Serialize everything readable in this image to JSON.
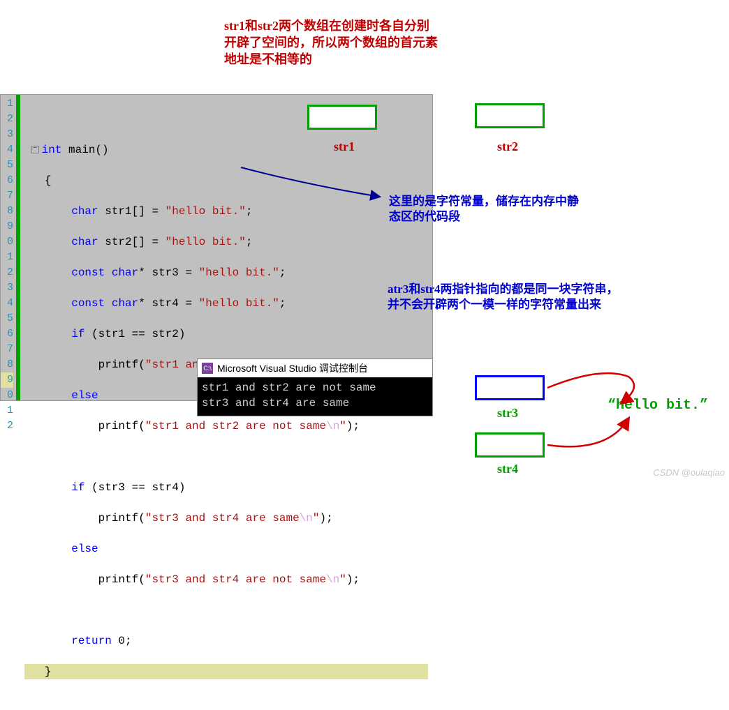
{
  "topNote": {
    "l1": "str1和str2两个数组在创建时各自分别",
    "l2": "开辟了空间的，所以两个数组的首元素",
    "l3": "地址是不相等的"
  },
  "gutterLines": [
    "1",
    "2",
    "3",
    "4",
    "5",
    "6",
    "7",
    "8",
    "9",
    "0",
    "1",
    "2",
    "3",
    "4",
    "5",
    "6",
    "7",
    "8",
    "9",
    "0",
    "1",
    "2"
  ],
  "code": {
    "kw_int": "int",
    "main": " main()",
    "brace_open": "{",
    "brace_close": "}",
    "kw_char": "char",
    "kw_const": "const",
    "kw_if": "if",
    "kw_else": "else",
    "kw_return": "return",
    "str1_decl": " str1[] = ",
    "str2_decl": " str2[] = ",
    "charstar": "*",
    "str3_decl": " str3 = ",
    "str4_decl": " str4 = ",
    "hello": "\"hello bit.\"",
    "semi": ";",
    "cond12": " (str1 == str2)",
    "cond34": " (str3 == str4)",
    "printf": "printf(",
    "close_paren": ");",
    "msg12s": "\"str1 and str2 are same",
    "msg12n": "\"str1 and str2 are not same",
    "msg34s": "\"str3 and str4 are same",
    "msg34n": "\"str3 and str4 are not same",
    "nl": "\\n",
    "endq": "\"",
    "ret": " 0;"
  },
  "console": {
    "iconLabel": "C:\\",
    "title": "Microsoft Visual Studio 调试控制台",
    "line1": "str1 and str2 are not same",
    "line2": "str3 and str4 are same"
  },
  "labels": {
    "str1": "str1",
    "str2": "str2",
    "str3": "str3",
    "str4": "str4",
    "hello": "“hello bit.”"
  },
  "anno1": {
    "l1": "这里的是字符常量，储存在内存中静",
    "l2": "态区的代码段"
  },
  "anno2": {
    "l1": "atr3和str4两指针指向的都是同一块字符串，",
    "l2": "并不会开辟两个一模一样的字符常量出来"
  },
  "watermark": "CSDN @oulaqiao"
}
